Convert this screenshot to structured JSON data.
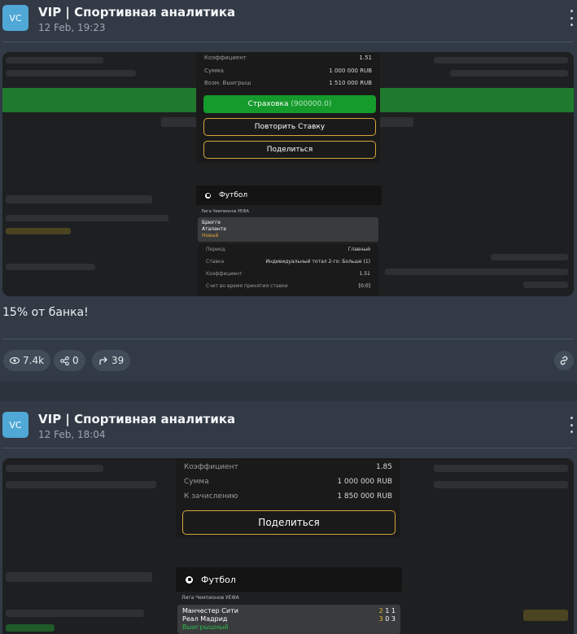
{
  "posts": [
    {
      "avatar": "VC",
      "channel": "VIP | Спортивная аналитика",
      "date": "12 Feb, 19:23",
      "bet": {
        "rows": [
          {
            "label": "Коэффициент",
            "value": "1.51"
          },
          {
            "label": "Сумма",
            "value": "1 000 000 RUB"
          },
          {
            "label": "Возм. Выигрыш",
            "value": "1 510 000 RUB"
          }
        ],
        "insurance_label": "Страховка",
        "insurance_amount": "(900000.0)",
        "repeat_label": "Повторить Ставку",
        "share_label": "Поделиться",
        "sport": "Футбол",
        "league": "Лига Чемпионов УЕФА",
        "team1": "Брюгге",
        "team2": "Аталанта",
        "status": "Новый",
        "details": [
          {
            "label": "Период",
            "value": "Главный"
          },
          {
            "label": "Ставка",
            "value": "Индивидуальный тотал 2-го: Больше (1)"
          },
          {
            "label": "Коэффициент",
            "value": "1.51"
          },
          {
            "label": "Счет во время принятия ставки",
            "value": "[0:0]"
          }
        ]
      },
      "caption": "15% от банка!",
      "views": "7.4k",
      "shares": "0",
      "forwards": "39"
    },
    {
      "avatar": "VC",
      "channel": "VIP | Спортивная аналитика",
      "date": "12 Feb, 18:04",
      "bet": {
        "rows": [
          {
            "label": "Коэффициент",
            "value": "1.85"
          },
          {
            "label": "Сумма",
            "value": "1 000 000 RUB"
          },
          {
            "label": "К зачислению",
            "value": "1 850 000 RUB"
          }
        ],
        "share_label": "Поделиться",
        "sport": "Футбол",
        "league": "Лига Чемпионов УЕФА",
        "team1": "Манчестер Сити",
        "team2": "Реал Мадрид",
        "status": "Выигрышный",
        "score1": [
          "2",
          "1",
          "1"
        ],
        "score2": [
          "3",
          "0",
          "3"
        ]
      }
    }
  ],
  "colors": {
    "background": "#313a45",
    "avatar": "#4fa8d6",
    "green_button": "#159a2c",
    "gold_outline": "#d9a53a"
  }
}
